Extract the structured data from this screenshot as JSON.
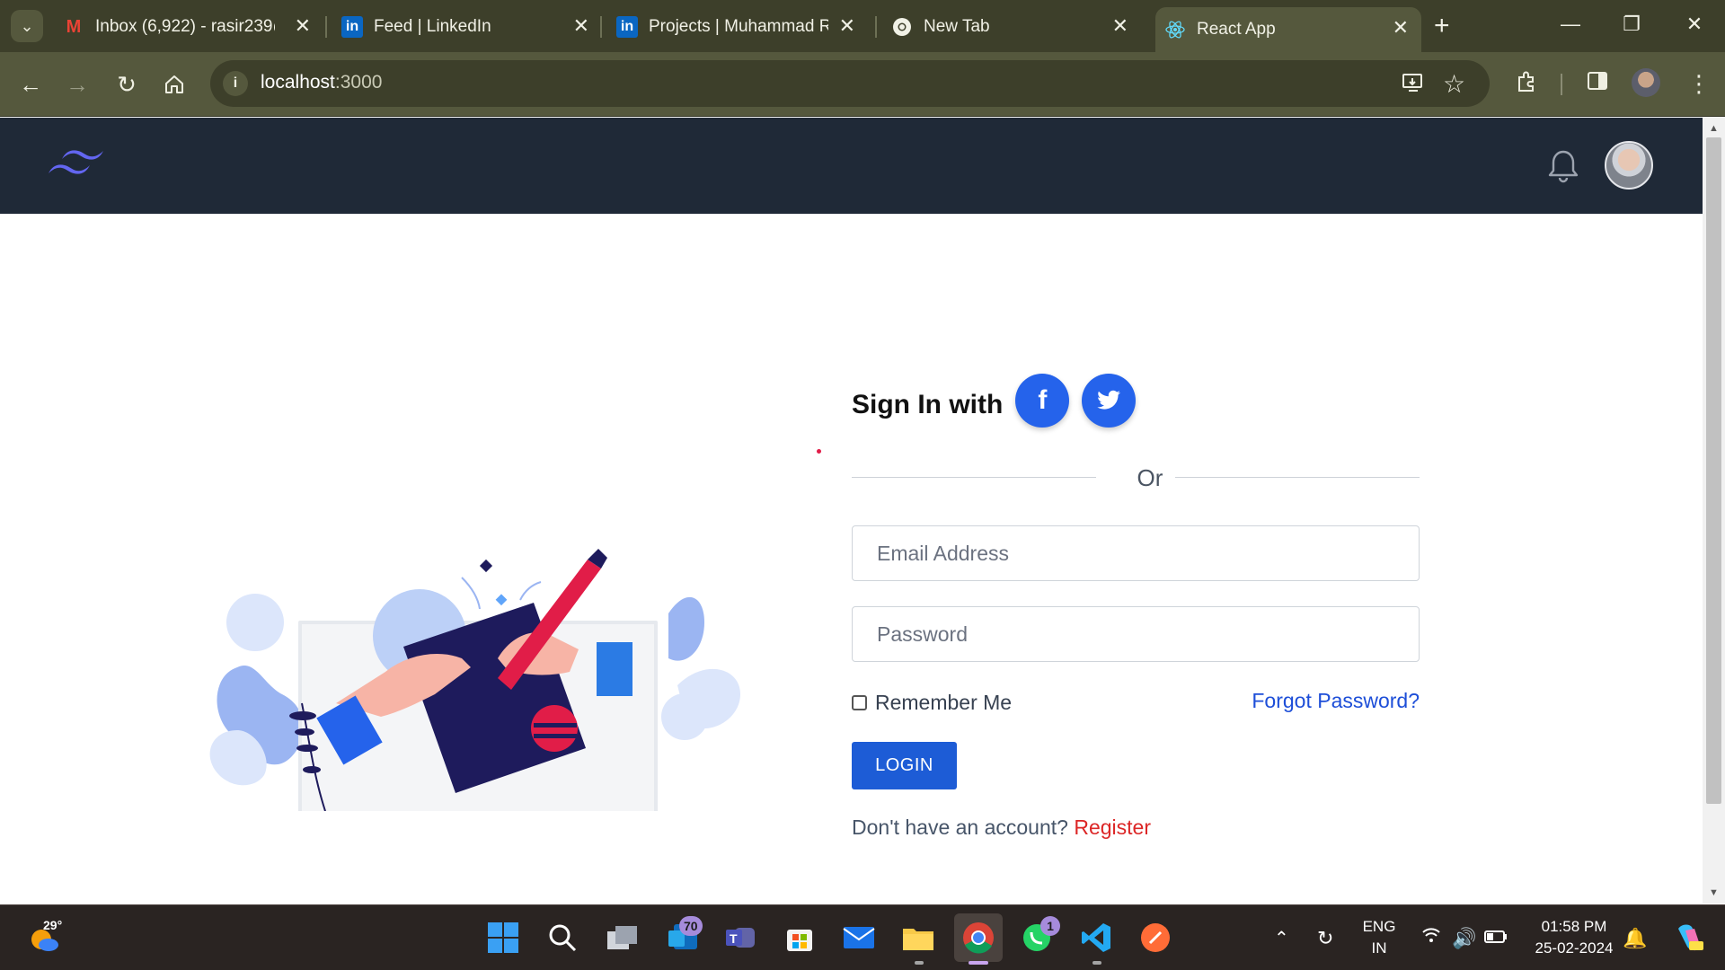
{
  "browser": {
    "tabs": [
      {
        "title": "Inbox (6,922) - rasir239@",
        "icon": "gmail-icon",
        "active": false
      },
      {
        "title": "Feed | LinkedIn",
        "icon": "linkedin-icon",
        "active": false
      },
      {
        "title": "Projects | Muhammad Ra",
        "icon": "linkedin-icon",
        "active": false
      },
      {
        "title": "New Tab",
        "icon": "chrome-icon",
        "active": false
      },
      {
        "title": "React App",
        "icon": "react-icon",
        "active": true
      }
    ],
    "url_host": "localhost",
    "url_port": ":3000",
    "colors": {
      "frame": "#3d3f2a",
      "toolbar": "#55583d"
    }
  },
  "app": {
    "nav_bg": "#1f2937",
    "logo": "tailwind-logo",
    "notification_icon": "bell-icon",
    "avatar_alt": "user-avatar"
  },
  "login": {
    "signin_title": "Sign In with",
    "social": [
      {
        "name": "facebook",
        "glyph": "f"
      },
      {
        "name": "twitter",
        "icon": "twitter-bird-icon"
      }
    ],
    "divider_text": "Or",
    "email_placeholder": "Email Address",
    "password_placeholder": "Password",
    "remember_label": "Remember Me",
    "remember_checked": false,
    "forgot_label": "Forgot Password?",
    "login_label": "LOGIN",
    "register_prompt": "Don't have an account?",
    "register_label": "Register",
    "accent": "#1d5cd6",
    "register_color": "#dc2626"
  },
  "taskbar": {
    "weather_temp": "29°",
    "badges": {
      "outlook": "70",
      "whatsapp": "1"
    },
    "lang_top": "ENG",
    "lang_bottom": "IN",
    "time": "01:58 PM",
    "date": "25-02-2024"
  }
}
